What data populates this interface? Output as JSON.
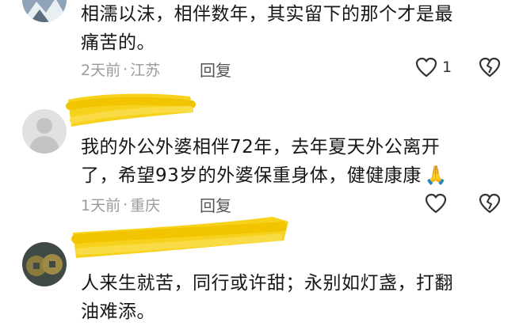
{
  "comments": [
    {
      "text_line1": "相濡以沫，相伴数年，其实留下的那个才是最",
      "text_line2": "痛苦的。",
      "time": "2天前",
      "separator": "·",
      "location": "江苏",
      "reply_label": "回复",
      "like_count": "1",
      "avatar": "mountain-landscape-avatar"
    },
    {
      "text_line1": "我的外公外婆相伴72年，去年夏天外公离开",
      "text_line2": "了，希望93岁的外婆保重身体，健健康康",
      "emoji": "🙏",
      "time": "1天前",
      "separator": "·",
      "location": "重庆",
      "reply_label": "回复",
      "like_count": "",
      "avatar": "default-gray-avatar"
    },
    {
      "text_line1": "人来生就苦，同行或许甜；永别如灯盏，打翻",
      "text_line2": "油难添。",
      "avatar": "coins-avatar"
    }
  ],
  "icons": {
    "like": "heart-outline-icon",
    "dislike": "broken-heart-icon"
  },
  "colors": {
    "scribble": "#f7d21c",
    "meta": "#9a9a9a",
    "text": "#161616"
  }
}
